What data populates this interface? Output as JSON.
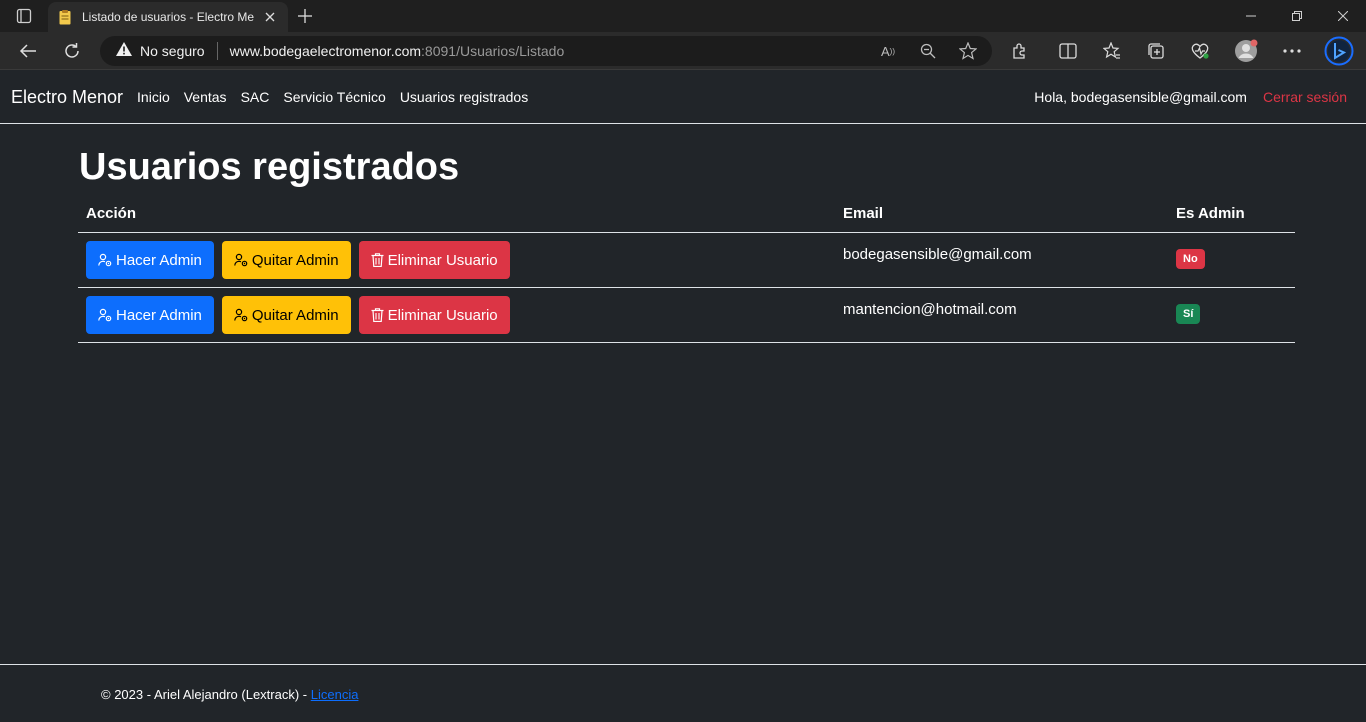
{
  "browser": {
    "tab_title": "Listado de usuarios - Electro Menor",
    "security_label": "No seguro",
    "url_host": "www.bodegaelectromenor.com",
    "url_rest": ":8091/Usuarios/Listado"
  },
  "navbar": {
    "brand": "Electro Menor",
    "links": [
      "Inicio",
      "Ventas",
      "SAC",
      "Servicio Técnico",
      "Usuarios registrados"
    ],
    "greeting": "Hola, bodegasensible@gmail.com",
    "logout": "Cerrar sesión"
  },
  "main": {
    "title": "Usuarios registrados",
    "columns": [
      "Acción",
      "Email",
      "Es Admin"
    ],
    "buttons": {
      "make_admin": "Hacer Admin",
      "remove_admin": "Quitar Admin",
      "delete_user": "Eliminar Usuario"
    },
    "rows": [
      {
        "email": "bodegasensible@gmail.com",
        "is_admin": "No"
      },
      {
        "email": "mantencion@hotmail.com",
        "is_admin": "Sí"
      }
    ]
  },
  "footer": {
    "text": "© 2023 - Ariel Alejandro (Lextrack) - ",
    "link": "Licencia"
  },
  "colors": {
    "page_bg": "#212529",
    "primary": "#0d6efd",
    "warning": "#ffc107",
    "danger": "#dc3545",
    "success": "#198754"
  }
}
